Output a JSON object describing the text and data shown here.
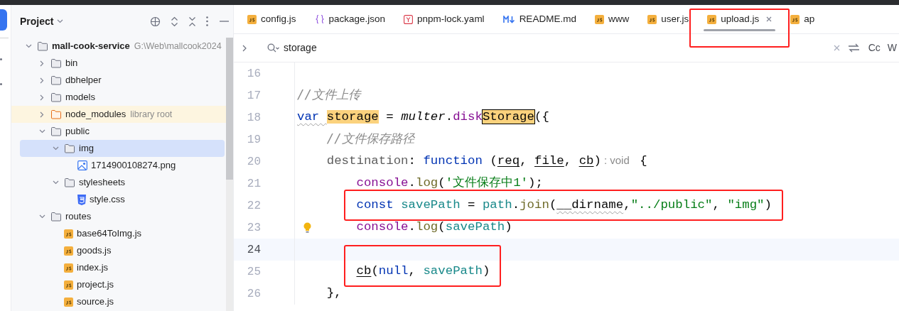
{
  "project_panel": {
    "title": "Project",
    "tree": [
      {
        "label": "mall-cook-service",
        "kind": "folder",
        "note": "G:\\Web\\mallcook2024",
        "expanded": true,
        "selected": false,
        "children": [
          {
            "label": "bin",
            "kind": "folder",
            "expanded": false,
            "selected": false
          },
          {
            "label": "dbhelper",
            "kind": "folder",
            "expanded": false,
            "selected": false
          },
          {
            "label": "models",
            "kind": "folder",
            "expanded": false,
            "selected": false
          },
          {
            "label": "node_modules",
            "kind": "library_folder",
            "note": "library root",
            "expanded": false,
            "selected": false
          },
          {
            "label": "public",
            "kind": "folder",
            "expanded": true,
            "selected": false,
            "children": [
              {
                "label": "img",
                "kind": "folder",
                "expanded": true,
                "selected": true,
                "children": [
                  {
                    "label": "1714900108274.png",
                    "kind": "image",
                    "selected": false
                  }
                ]
              },
              {
                "label": "stylesheets",
                "kind": "folder",
                "expanded": true,
                "selected": false,
                "children": [
                  {
                    "label": "style.css",
                    "kind": "css",
                    "selected": false
                  }
                ]
              }
            ]
          },
          {
            "label": "routes",
            "kind": "folder",
            "expanded": true,
            "selected": false,
            "children": [
              {
                "label": "base64ToImg.js",
                "kind": "js",
                "selected": false
              },
              {
                "label": "goods.js",
                "kind": "js",
                "selected": false
              },
              {
                "label": "index.js",
                "kind": "js",
                "selected": false
              },
              {
                "label": "project.js",
                "kind": "js",
                "selected": false
              },
              {
                "label": "source.js",
                "kind": "js",
                "selected": false
              }
            ]
          }
        ]
      }
    ]
  },
  "tabs": [
    {
      "label": "config.js",
      "kind": "js",
      "selected": false
    },
    {
      "label": "package.json",
      "kind": "json",
      "selected": false
    },
    {
      "label": "pnpm-lock.yaml",
      "kind": "yaml",
      "selected": false
    },
    {
      "label": "README.md",
      "kind": "md",
      "selected": false
    },
    {
      "label": "www",
      "kind": "js",
      "selected": false
    },
    {
      "label": "user.js",
      "kind": "js",
      "selected": false
    },
    {
      "label": "upload.js",
      "kind": "js",
      "selected": true,
      "closable": true,
      "boxed": true
    },
    {
      "label": "ap",
      "kind": "js",
      "selected": false
    }
  ],
  "search": {
    "value": "storage",
    "toggles": [
      "Cc",
      "W"
    ]
  },
  "code": {
    "lines": [
      {
        "number": "16",
        "current": false
      },
      {
        "number": "17",
        "current": false,
        "tokens": [
          {
            "text": "//文件上传",
            "kind": "comment"
          }
        ]
      },
      {
        "number": "18",
        "current": false,
        "tokens": [
          {
            "text": "var ",
            "kind": "keyword",
            "squiggle": true
          },
          {
            "text": "storage",
            "kind": "match"
          },
          {
            "text": " = ",
            "kind": "plain"
          },
          {
            "text": "multer",
            "kind": "italic"
          },
          {
            "text": ".",
            "kind": "plain"
          },
          {
            "text": "disk",
            "kind": "method"
          },
          {
            "text": "Storage",
            "kind": "match_current"
          },
          {
            "text": "({",
            "kind": "plain"
          }
        ]
      },
      {
        "number": "19",
        "current": false,
        "tokens": [
          {
            "text": "    //文件保存路径",
            "kind": "comment"
          }
        ]
      },
      {
        "number": "20",
        "current": false,
        "tokens": [
          {
            "text": "    destination",
            "kind": "field"
          },
          {
            "text": ": ",
            "kind": "plain"
          },
          {
            "text": "function",
            "kind": "keyword"
          },
          {
            "text": " (",
            "kind": "plain"
          },
          {
            "text": "req",
            "kind": "param"
          },
          {
            "text": ", ",
            "kind": "plain"
          },
          {
            "text": "file",
            "kind": "param"
          },
          {
            "text": ", ",
            "kind": "plain"
          },
          {
            "text": "cb",
            "kind": "param"
          },
          {
            "text": ")",
            "kind": "plain"
          },
          {
            "text": ": void",
            "kind": "hint"
          },
          {
            "text": " {",
            "kind": "plain"
          }
        ]
      },
      {
        "number": "21",
        "current": false,
        "tokens": [
          {
            "text": "        console",
            "kind": "method"
          },
          {
            "text": ".",
            "kind": "plain"
          },
          {
            "text": "log",
            "kind": "call"
          },
          {
            "text": "(",
            "kind": "plain"
          },
          {
            "text": "'文件保存中1'",
            "kind": "string"
          },
          {
            "text": ");",
            "kind": "plain"
          }
        ]
      },
      {
        "number": "22",
        "current": false,
        "boxed": true,
        "tokens": [
          {
            "text": "        const ",
            "kind": "keyword"
          },
          {
            "text": "savePath",
            "kind": "var"
          },
          {
            "text": " = ",
            "kind": "plain"
          },
          {
            "text": "path",
            "kind": "var"
          },
          {
            "text": ".",
            "kind": "plain"
          },
          {
            "text": "join",
            "kind": "call"
          },
          {
            "text": "(",
            "kind": "plain"
          },
          {
            "text": "__dirname",
            "kind": "plain",
            "squiggle": true
          },
          {
            "text": ",",
            "kind": "plain"
          },
          {
            "text": "\"../public\"",
            "kind": "string"
          },
          {
            "text": ", ",
            "kind": "plain"
          },
          {
            "text": "\"img\"",
            "kind": "string"
          },
          {
            "text": ")",
            "kind": "plain"
          }
        ]
      },
      {
        "number": "23",
        "current": false,
        "bulb": true,
        "tokens": [
          {
            "text": "        console",
            "kind": "method"
          },
          {
            "text": ".",
            "kind": "plain"
          },
          {
            "text": "log",
            "kind": "call"
          },
          {
            "text": "(",
            "kind": "plain"
          },
          {
            "text": "savePath",
            "kind": "var"
          },
          {
            "text": ")",
            "kind": "plain"
          }
        ]
      },
      {
        "number": "24",
        "current": true,
        "boxed": true
      },
      {
        "number": "25",
        "current": false,
        "boxed": true,
        "tokens": [
          {
            "text": "        cb",
            "kind": "param"
          },
          {
            "text": "(",
            "kind": "plain"
          },
          {
            "text": "null",
            "kind": "keyword"
          },
          {
            "text": ", ",
            "kind": "plain"
          },
          {
            "text": "savePath",
            "kind": "var"
          },
          {
            "text": ")",
            "kind": "plain"
          }
        ]
      },
      {
        "number": "26",
        "current": false,
        "tokens": [
          {
            "text": "    },",
            "kind": "plain"
          }
        ]
      }
    ]
  }
}
